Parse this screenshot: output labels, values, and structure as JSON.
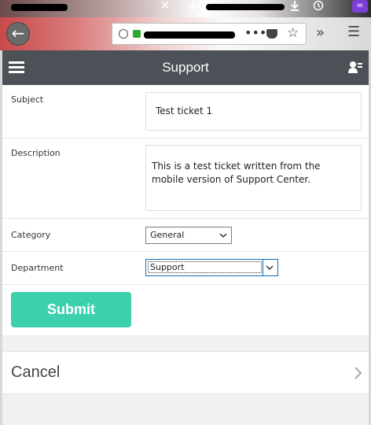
{
  "browser": {
    "icons": [
      "close-icon",
      "plus-icon",
      "download-icon",
      "clock-icon",
      "mask-icon",
      "back-icon",
      "info-icon",
      "lock-icon",
      "more-icon",
      "pocket-icon",
      "star-icon",
      "overflow-icon",
      "menu-icon"
    ],
    "close_glyph": "✕",
    "new_tab_glyph": "+",
    "more_glyph": "•••",
    "star_glyph": "☆",
    "overflow_glyph": "»",
    "menu_glyph": "☰",
    "back_glyph": "←"
  },
  "header": {
    "title": "Support"
  },
  "form": {
    "subject_label": "Subject",
    "subject_value": "Test ticket 1",
    "description_label": "Description",
    "description_value": "This is a test ticket written from the mobile version of Support Center.",
    "category_label": "Category",
    "category_value": "General",
    "department_label": "Department",
    "department_value": "Support",
    "submit_label": "Submit"
  },
  "cancel": {
    "label": "Cancel"
  },
  "colors": {
    "header_bg": "#4b5156",
    "submit_bg": "#3cd0ad",
    "focus_border": "#0a6ebd"
  }
}
